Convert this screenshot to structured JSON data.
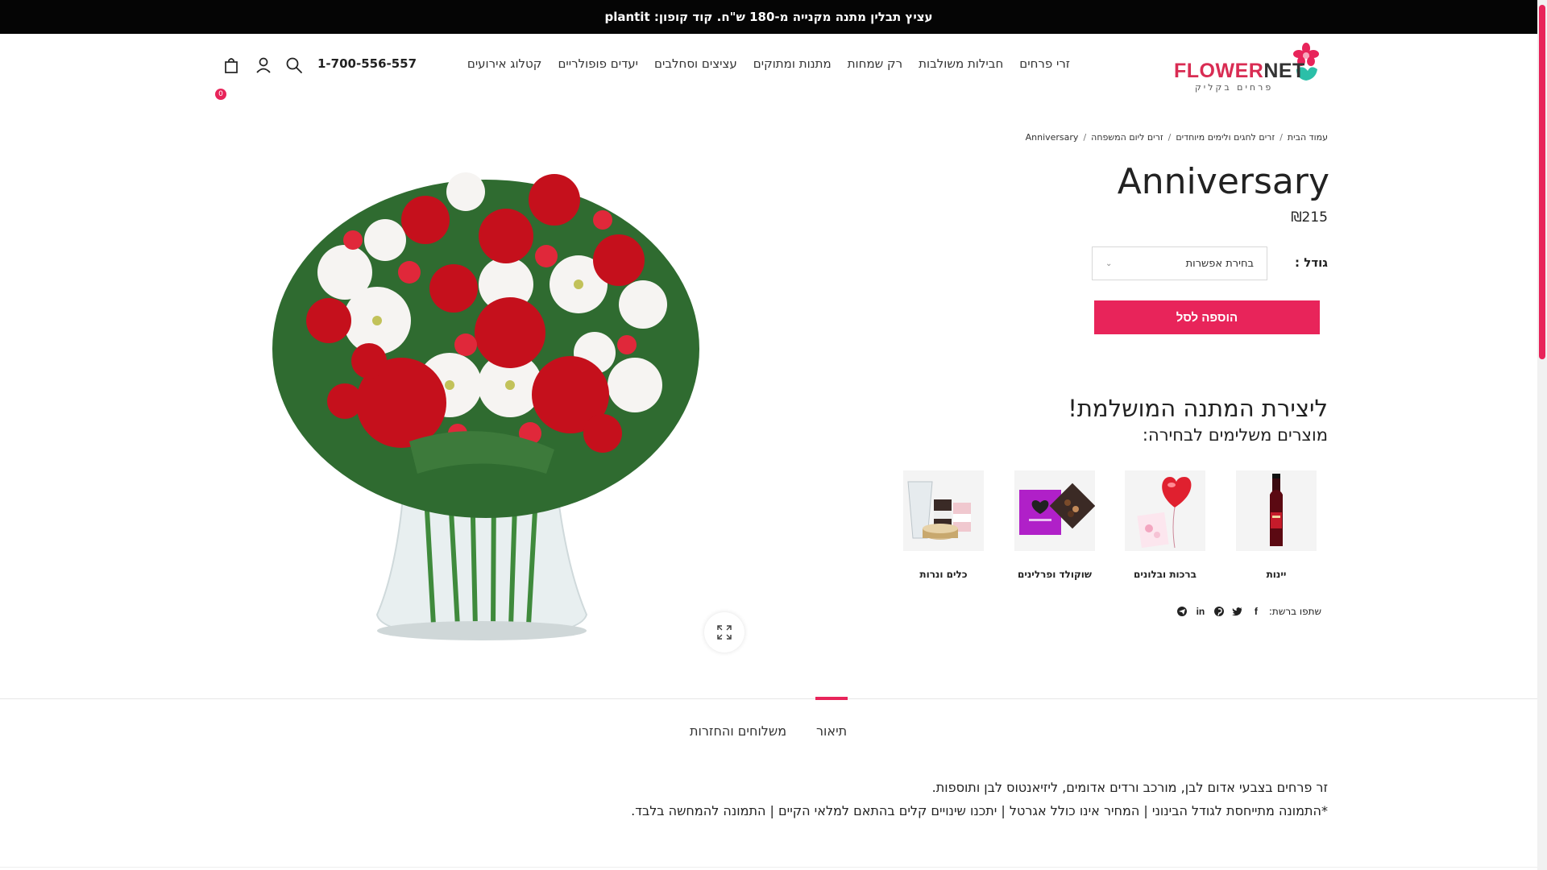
{
  "promo": {
    "text": "עציץ תבלין מתנה מקנייה מ-180 ש\"ח. קוד קופון: plantit"
  },
  "header": {
    "logo": {
      "brand_part1": "FLOWER",
      "brand_part2": "NET",
      "tagline": "פרחים בקליק"
    },
    "nav": [
      "זרי פרחים",
      "חבילות משולבות",
      "רק שמחות",
      "מתנות ומתוקים",
      "עציצים וסחלבים",
      "יעדים פופולריים",
      "קטלוג אירועים"
    ],
    "phone": "1-700-556-557",
    "cart_count": "0",
    "icons": [
      "search-icon",
      "user-icon",
      "cart-icon"
    ]
  },
  "breadcrumb": [
    "עמוד הבית",
    "זרים לחגים ולימים מיוחדים",
    "זרים ליום המשפחה",
    "Anniversary"
  ],
  "product": {
    "title": "Anniversary",
    "price": "₪215",
    "size_label": "גודל :",
    "size_select_value": "בחירת אפשרות",
    "add_to_cart": "הוספה לסל"
  },
  "upsell": {
    "title": "ליצירת המתנה המושלמת!",
    "subtitle": "מוצרים משלימים לבחירה:",
    "items": [
      "יינות",
      "ברכות ובלונים",
      "שוקולד ופרלינים",
      "כלים ונרות"
    ]
  },
  "share": {
    "label": "שתפו ברשת:",
    "icons": [
      "facebook-icon",
      "twitter-icon",
      "pinterest-icon",
      "linkedin-icon",
      "telegram-icon"
    ]
  },
  "tabs": {
    "items": [
      "תיאור",
      "משלוחים והחזרות"
    ],
    "active": "תיאור"
  },
  "description": {
    "line1": "זר פרחים בצבעי אדום לבן, מורכב ורדים אדומים, ליזיאנטוס לבן ותוספות.",
    "line2": "*התמונה מתייחסת לגודל הבינוני | המחיר אינו כולל אגרטל | יתכנו שינויים קלים בהתאם למלאי הקיים | התמונה להמחשה בלבד."
  },
  "colors": {
    "accent": "#e8245a",
    "promo_bg": "#050505",
    "text": "#222222"
  }
}
